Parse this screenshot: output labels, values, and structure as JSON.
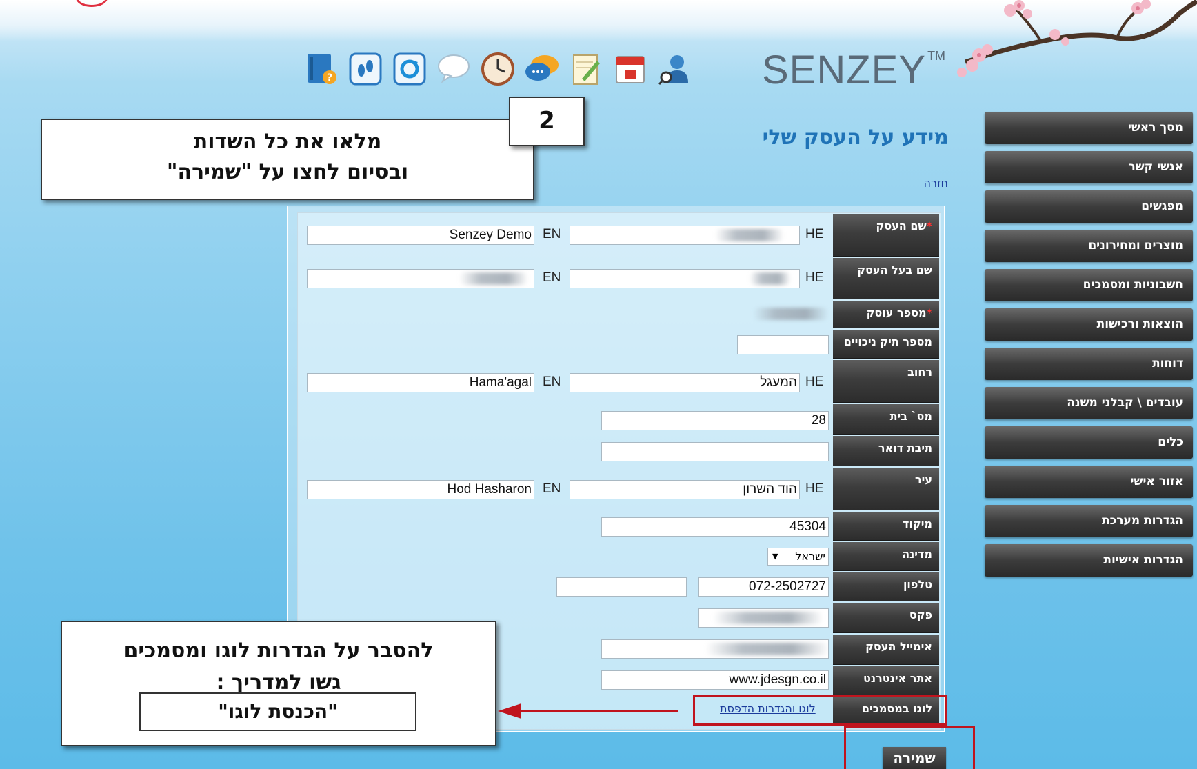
{
  "brand": {
    "name": "SENZEY",
    "tm": "TM"
  },
  "toolbar": {
    "icons": [
      "help-book-icon",
      "footsteps-icon",
      "sync-icon",
      "speech-bubble-icon",
      "clock-icon",
      "chat-icon",
      "notes-icon",
      "calendar-icon",
      "user-search-icon"
    ]
  },
  "sidebar": {
    "items": [
      {
        "label": "מסך ראשי"
      },
      {
        "label": "אנשי קשר"
      },
      {
        "label": "מפגשים"
      },
      {
        "label": "מוצרים ומחירונים"
      },
      {
        "label": "חשבוניות ומסמכים"
      },
      {
        "label": "הוצאות ורכישות"
      },
      {
        "label": "דוחות"
      },
      {
        "label": "עובדים \\ קבלני משנה"
      },
      {
        "label": "כלים"
      },
      {
        "label": "אזור אישי"
      },
      {
        "label": "הגדרות מערכת"
      },
      {
        "label": "הגדרות אישיות"
      }
    ]
  },
  "page": {
    "title": "מידע על העסק שלי",
    "back_link": "חזרה"
  },
  "form": {
    "lang_he": "HE",
    "lang_en": "EN",
    "required_mark": "*",
    "business_name": {
      "label": "שם העסק",
      "en_value": "Senzey Demo"
    },
    "owner_name": {
      "label": "שם בעל העסק"
    },
    "business_number": {
      "label": "מספר עוסק"
    },
    "tax_file": {
      "label": "מספר תיק ניכויים",
      "value": ""
    },
    "street": {
      "label": "רחוב",
      "he_value": "המעגל",
      "en_value": "Hama'agal"
    },
    "house_number": {
      "label": "מס` בית",
      "value": "28"
    },
    "po_box": {
      "label": "תיבת דואר",
      "value": ""
    },
    "city": {
      "label": "עיר",
      "he_value": "הוד השרון",
      "en_value": "Hod Hasharon"
    },
    "zip": {
      "label": "מיקוד",
      "value": "45304"
    },
    "country": {
      "label": "מדינה",
      "value": "ישראל"
    },
    "phone": {
      "label": "טלפון",
      "value": "072-2502727",
      "value2": ""
    },
    "fax": {
      "label": "פקס"
    },
    "email": {
      "label": "אימייל העסק"
    },
    "website": {
      "label": "אתר אינטרנט",
      "value": "www.jdesgn.co.il"
    },
    "logo": {
      "label": "לוגו במסמכים",
      "link": "לוגו והגדרות הדפסת"
    },
    "save_label": "שמירה"
  },
  "annotations": {
    "step_number": "2",
    "fill_line1": "מלאו את כל השדות",
    "fill_line2": "ובסיום לחצו על \"שמירה\"",
    "logo_line1": "להסבר על הגדרות לוגו ומסמכים",
    "logo_line2": "גשו למדריך :",
    "logo_guide": "\"הכנסת לוגו\""
  },
  "colors": {
    "accent": "#1f73b7",
    "menu_dark": "#2c2c2c",
    "annotation_red": "#c0141e"
  }
}
